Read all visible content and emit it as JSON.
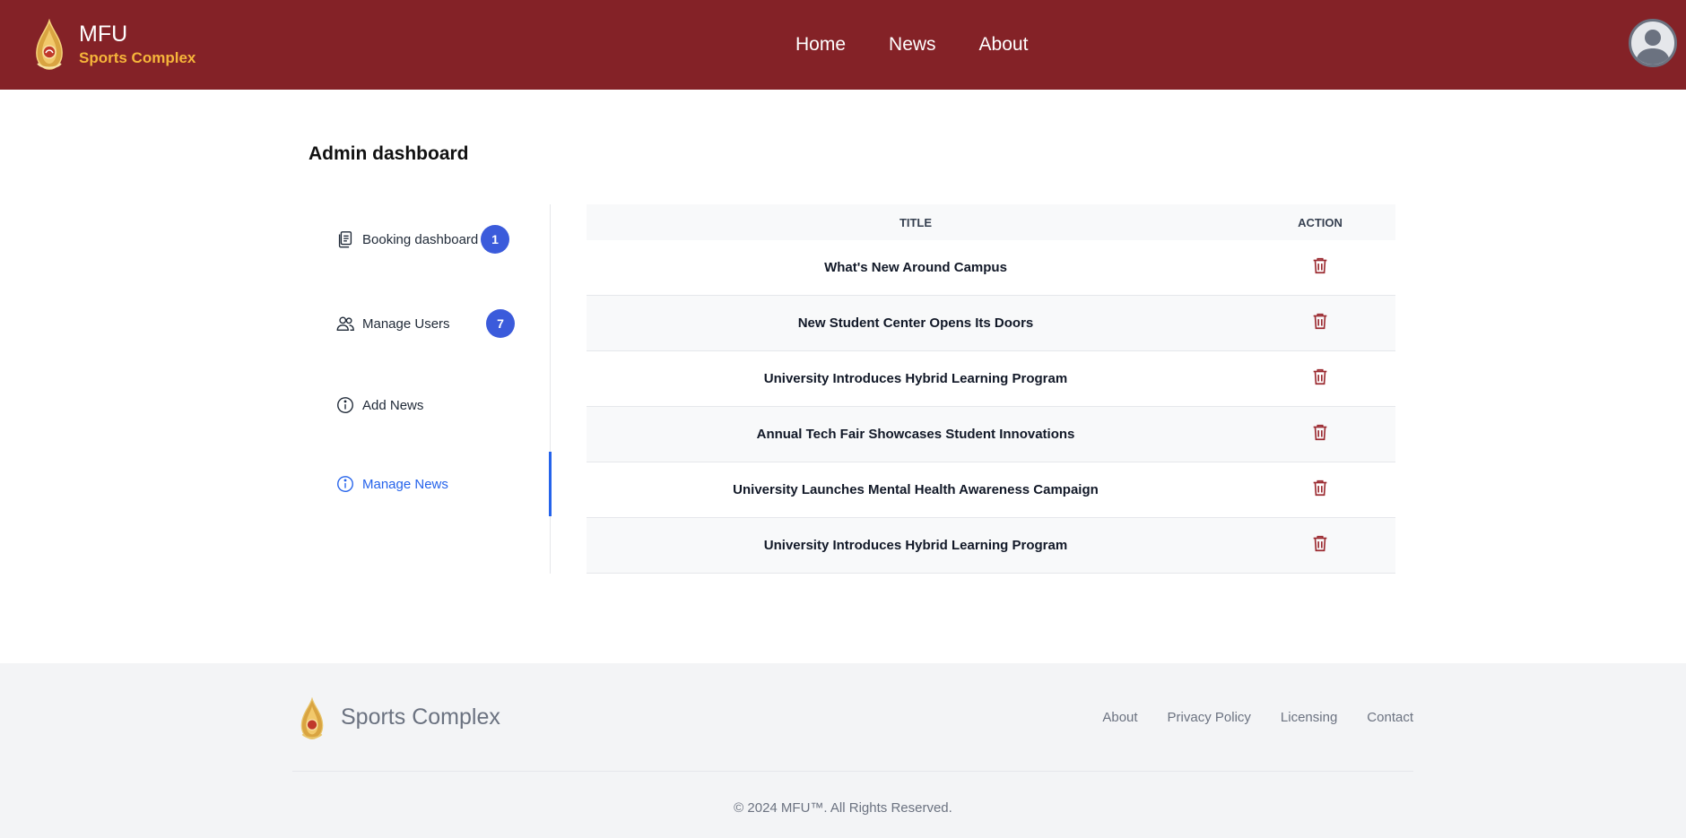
{
  "header": {
    "brand_title": "MFU",
    "brand_subtitle": "Sports Complex",
    "nav": [
      {
        "label": "Home"
      },
      {
        "label": "News"
      },
      {
        "label": "About"
      }
    ],
    "avatar_icon": "user-avatar-icon"
  },
  "main": {
    "page_title": "Admin dashboard",
    "sidebar": [
      {
        "label": "Booking dashboard",
        "icon": "document-copy-icon",
        "badge": "1"
      },
      {
        "label": "Manage Users",
        "icon": "users-icon",
        "badge": "7"
      },
      {
        "label": "Add News",
        "icon": "info-icon"
      },
      {
        "label": "Manage News",
        "icon": "info-icon",
        "active": true
      }
    ],
    "table": {
      "columns": [
        "Title",
        "Action"
      ],
      "rows": [
        {
          "title": "What's New Around Campus"
        },
        {
          "title": "New Student Center Opens Its Doors"
        },
        {
          "title": "University Introduces Hybrid Learning Program"
        },
        {
          "title": "Annual Tech Fair Showcases Student Innovations"
        },
        {
          "title": "University Launches Mental Health Awareness Campaign"
        },
        {
          "title": "University Introduces Hybrid Learning Program"
        }
      ],
      "action_icon": "trash-icon"
    }
  },
  "footer": {
    "brand": "Sports Complex",
    "links": [
      {
        "label": "About"
      },
      {
        "label": "Privacy Policy"
      },
      {
        "label": "Licensing"
      },
      {
        "label": "Contact"
      }
    ],
    "copyright": "© 2024 MFU™. All Rights Reserved."
  },
  "colors": {
    "header_bg": "#842227",
    "brand_accent": "#f6b53a",
    "badge_bg": "#3b5bdb",
    "active_blue": "#2563eb",
    "trash_red": "#9b2a30"
  }
}
